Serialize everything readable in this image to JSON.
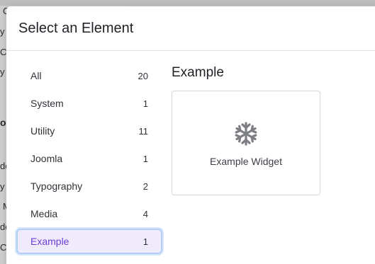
{
  "background": {
    "snippets": [
      "C",
      "y",
      "Ca",
      "y",
      "or",
      "de",
      "y",
      "M",
      "de",
      "Ca"
    ]
  },
  "modal": {
    "title": "Select an Element"
  },
  "categories": [
    {
      "label": "All",
      "count": "20"
    },
    {
      "label": "System",
      "count": "1"
    },
    {
      "label": "Utility",
      "count": "11"
    },
    {
      "label": "Joomla",
      "count": "1"
    },
    {
      "label": "Typography",
      "count": "2"
    },
    {
      "label": "Media",
      "count": "4"
    },
    {
      "label": "Example",
      "count": "1"
    }
  ],
  "active_category": "Example",
  "content": {
    "section_title": "Example",
    "elements": [
      {
        "label": "Example Widget",
        "icon": "snowflake-icon"
      }
    ]
  },
  "colors": {
    "accent": "#6b3fd8",
    "active_bg": "#efeafc",
    "active_border": "#b3cff7",
    "icon": "#7d7f84"
  }
}
